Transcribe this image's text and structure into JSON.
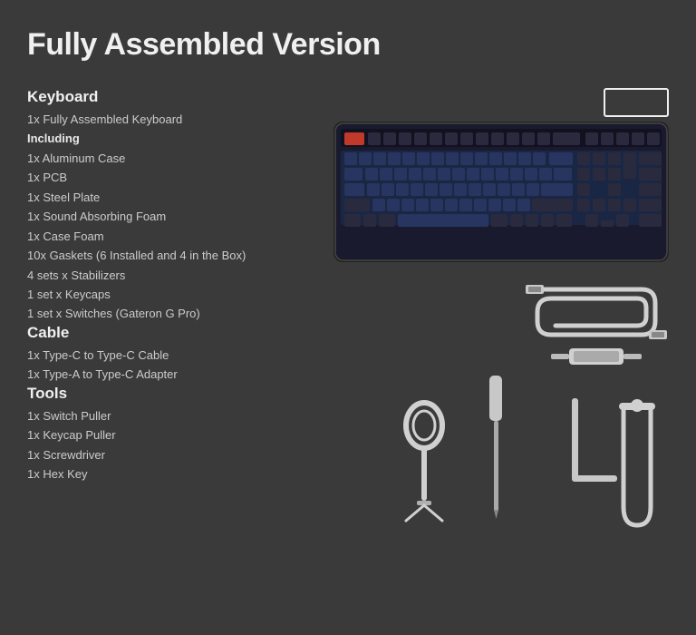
{
  "page": {
    "title": "Fully Assembled Version",
    "background_color": "#3a3a3a"
  },
  "sections": {
    "keyboard": {
      "title": "Keyboard",
      "items": [
        {
          "text": "1x Fully Assembled Keyboard",
          "bold": false
        },
        {
          "text": "Including",
          "bold": true
        },
        {
          "text": "1x Aluminum Case",
          "bold": false
        },
        {
          "text": "1x PCB",
          "bold": false
        },
        {
          "text": "1x Steel Plate",
          "bold": false
        },
        {
          "text": "1x Sound Absorbing Foam",
          "bold": false
        },
        {
          "text": "1x Case Foam",
          "bold": false
        },
        {
          "text": "10x Gaskets (6 Installed and 4 in the Box)",
          "bold": false
        },
        {
          "text": "4 sets x Stabilizers",
          "bold": false
        },
        {
          "text": "1 set x Keycaps",
          "bold": false
        },
        {
          "text": "1 set x Switches (Gateron G Pro)",
          "bold": false
        }
      ]
    },
    "cable": {
      "title": "Cable",
      "items": [
        {
          "text": "1x Type-C to Type-C Cable",
          "bold": false
        },
        {
          "text": "1x Type-A to Type-C Adapter",
          "bold": false
        }
      ]
    },
    "tools": {
      "title": "Tools",
      "items": [
        {
          "text": "1x Switch Puller",
          "bold": false
        },
        {
          "text": "1x Keycap Puller",
          "bold": false
        },
        {
          "text": "1x Screwdriver",
          "bold": false
        },
        {
          "text": "1x Hex Key",
          "bold": false
        }
      ]
    }
  }
}
